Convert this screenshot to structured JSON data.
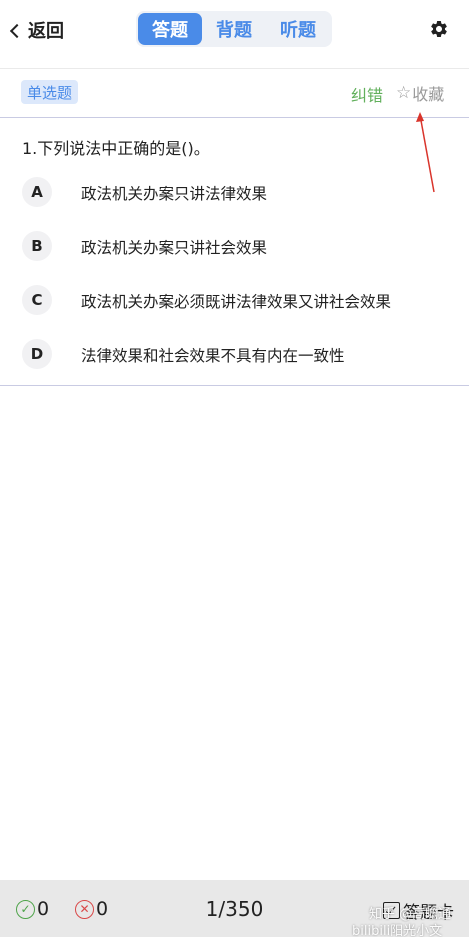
{
  "header": {
    "back_label": "返回",
    "tabs": [
      {
        "label": "答题",
        "active": true
      },
      {
        "label": "背题",
        "active": false
      },
      {
        "label": "听题",
        "active": false
      }
    ],
    "settings_icon": "gear-icon"
  },
  "subbar": {
    "question_type": "单选题",
    "report_label": "纠错",
    "favorite_label": "收藏",
    "favorite_icon": "star-outline-icon"
  },
  "question": {
    "text": "1.下列说法中正确的是()。",
    "options": [
      {
        "letter": "A",
        "text": "政法机关办案只讲法律效果"
      },
      {
        "letter": "B",
        "text": "政法机关办案只讲社会效果"
      },
      {
        "letter": "C",
        "text": "政法机关办案必须既讲法律效果又讲社会效果"
      },
      {
        "letter": "D",
        "text": "法律效果和社会效果不具有内在一致性"
      }
    ]
  },
  "footer": {
    "correct_count": "0",
    "wrong_count": "0",
    "progress": "1/350",
    "card_label": "答题卡"
  },
  "watermarks": {
    "line1": "知乎 @高瞻通",
    "line2": "bilibili阳光小文"
  },
  "colors": {
    "accent": "#4a8be8",
    "report": "#62b05c",
    "correct": "#4fa44a",
    "wrong": "#d94848",
    "arrow": "#d9342b"
  }
}
